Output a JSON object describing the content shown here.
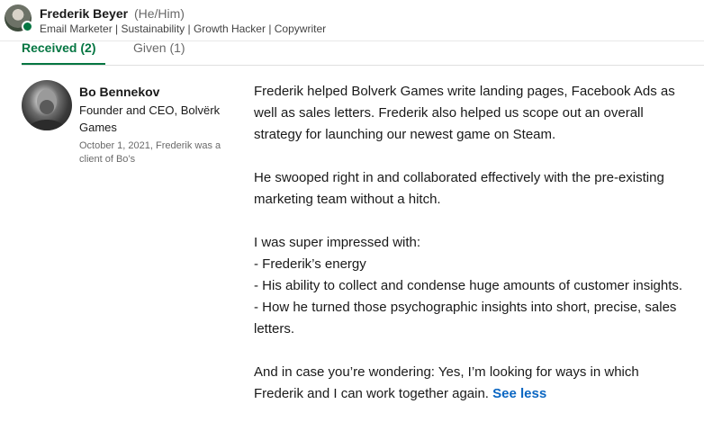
{
  "profile": {
    "name": "Frederik Beyer",
    "pronouns": "(He/Him)",
    "headline": "Email Marketer | Sustainability | Growth Hacker | Copywriter"
  },
  "tabs": [
    {
      "label": "Received (2)"
    },
    {
      "label": "Given (1)"
    }
  ],
  "recommendation": {
    "recommender_name": "Bo Bennekov",
    "recommender_title": "Founder and CEO, Bolvërk Games",
    "meta": "October 1, 2021, Frederik was a client of Bo’s",
    "paragraphs": [
      "Frederik helped Bolverk Games write landing pages, Facebook Ads as well as sales letters. Frederik also helped us scope out an overall strategy for launching our newest game on Steam.",
      "He swooped right in and collaborated effectively with the pre-existing marketing team without a hitch."
    ],
    "impressed_intro": "I was super impressed with:",
    "impressed_items": [
      "- Frederik’s energy",
      "- His ability to collect and condense huge amounts of customer insights.",
      "- How he turned those psychographic insights into short, precise, sales letters."
    ],
    "closing": "And in case you’re wondering: Yes, I’m looking for ways in which Frederik and I can work together again.",
    "see_less_label": "See less"
  },
  "colors": {
    "accent_green": "#057642",
    "link_blue": "#0a66c2"
  }
}
